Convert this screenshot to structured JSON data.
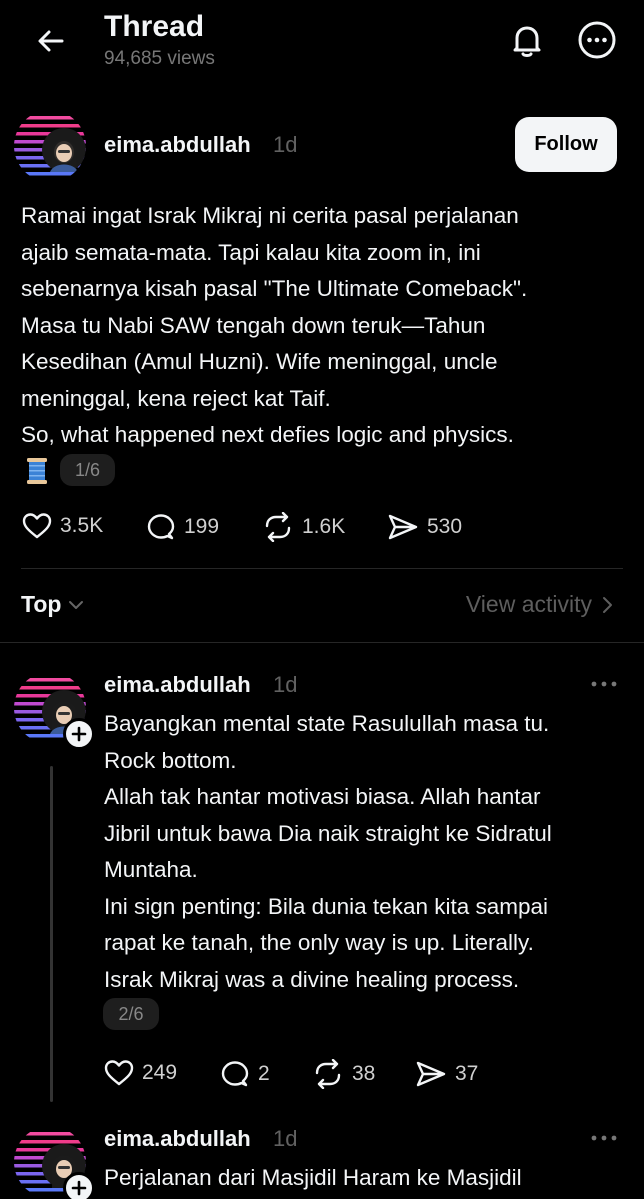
{
  "header": {
    "title": "Thread",
    "views": "94,685 views",
    "back_icon": "arrow-left-icon",
    "bell_icon": "bell-icon",
    "more_icon": "more-icon"
  },
  "post": {
    "username": "eima.abdullah",
    "time": "1d",
    "follow_label": "Follow",
    "lines": [
      "Ramai ingat Israk Mikraj ni cerita pasal perjalanan",
      "ajaib semata-mata. Tapi kalau kita zoom in, ini",
      "sebenarnya kisah pasal \"The Ultimate Comeback\".",
      "Masa tu Nabi SAW tengah down teruk—Tahun",
      "Kesedihan (Amul Huzni). Wife meninggal, uncle",
      "meninggal, kena reject kat Taif.",
      "So, what happened next defies logic and physics."
    ],
    "pager": "1/6",
    "likes": "3.5K",
    "replies": "199",
    "reposts": "1.6K",
    "shares": "530"
  },
  "sort": {
    "label": "Top",
    "view_activity": "View activity"
  },
  "replies": [
    {
      "username": "eima.abdullah",
      "time": "1d",
      "lines": [
        "Bayangkan mental state Rasulullah masa tu.",
        "Rock bottom.",
        "Allah tak hantar motivasi biasa. Allah hantar",
        "Jibril untuk bawa Dia naik straight ke Sidratul",
        "Muntaha.",
        "Ini sign penting: Bila dunia tekan kita sampai",
        "rapat ke tanah, the only way is up. Literally.",
        "Israk Mikraj was a divine healing process."
      ],
      "pager": "2/6",
      "likes": "249",
      "replies": "2",
      "reposts": "38",
      "shares": "37"
    },
    {
      "username": "eima.abdullah",
      "time": "1d",
      "lines": [
        "Perjalanan dari Masjidil Haram ke Masjidil"
      ]
    }
  ],
  "colors": {
    "background": "#000000",
    "text": "#f3f5f7",
    "muted": "#616161",
    "follow_bg": "#f3f5f7",
    "divider": "#262626"
  }
}
